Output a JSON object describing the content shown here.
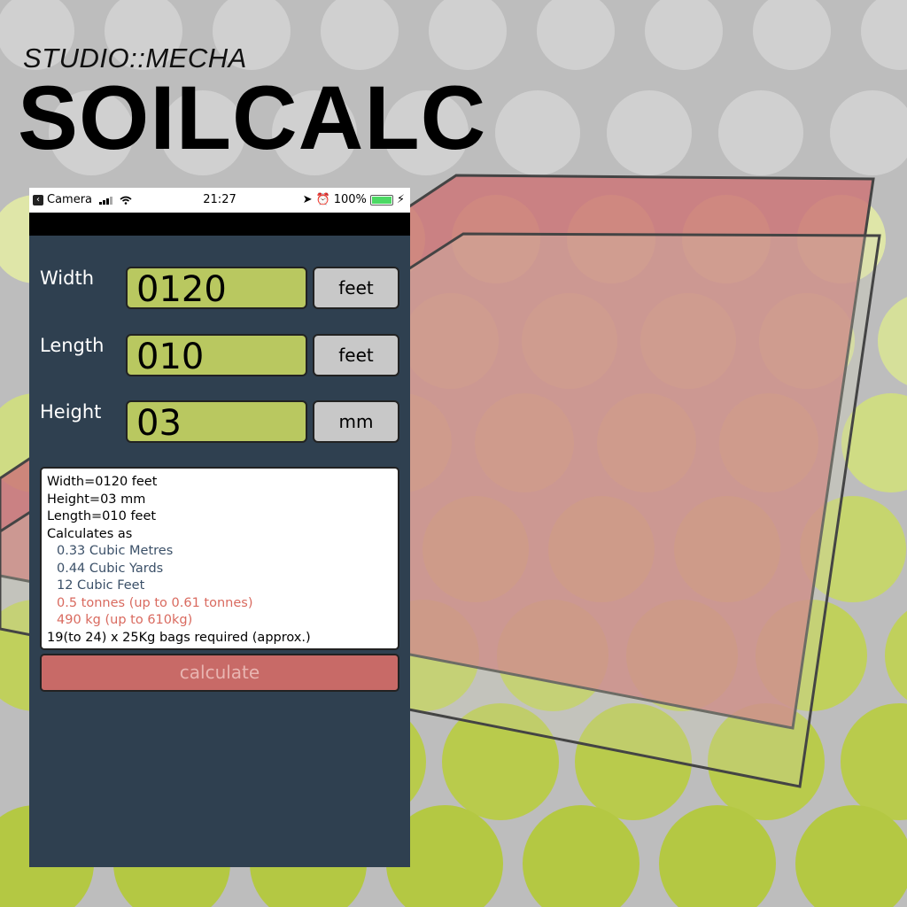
{
  "brand": {
    "subtitle": "STUDIO::MECHA",
    "title": "SOILCALC"
  },
  "status_bar": {
    "back_app": "Camera",
    "time": "21:27",
    "battery": "100%",
    "battery_level": 1.0
  },
  "form": {
    "fields": [
      {
        "label": "Width",
        "value": "0120",
        "unit": "feet"
      },
      {
        "label": "Length",
        "value": "010",
        "unit": "feet"
      },
      {
        "label": "Height",
        "value": "03",
        "unit": "mm"
      }
    ]
  },
  "results": {
    "width_line": "Width=0120 feet",
    "height_line": "Height=03 mm",
    "length_line": "Length=010 feet",
    "calc_header": "Calculates as",
    "cubic_metres": "0.33 Cubic Metres",
    "cubic_yards": "0.44 Cubic Yards",
    "cubic_feet": "12 Cubic Feet",
    "tonnes": "0.5 tonnes (up to 0.61 tonnes)",
    "kg": "490 kg (up to 610kg)",
    "bags": "19(to 24) x 25Kg bags required (approx.)"
  },
  "calculate_label": "calculate",
  "colors": {
    "background": "#bdbdbd",
    "phone_bg": "#2f4050",
    "field_green": "#b9c860",
    "unit_gray": "#c8c8c8",
    "button_red": "#c86a67",
    "result_blue": "#3b5068",
    "result_red": "#d96a5f"
  }
}
